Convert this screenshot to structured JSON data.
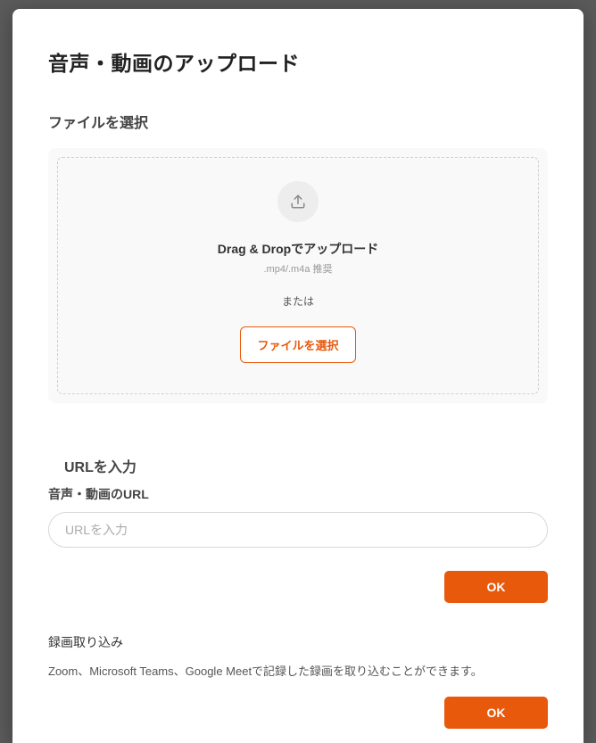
{
  "modal": {
    "title": "音声・動画のアップロード"
  },
  "fileSelect": {
    "sectionLabel": "ファイルを選択",
    "dropTitle": "Drag & Dropでアップロード",
    "dropSub": ".mp4/.m4a 推奨",
    "or": "または",
    "buttonLabel": "ファイルを選択"
  },
  "urlSection": {
    "title": "URLを入力",
    "subLabel": "音声・動画のURL",
    "placeholder": "URLを入力",
    "value": "",
    "okLabel": "OK"
  },
  "importSection": {
    "title": "録画取り込み",
    "description": "Zoom、Microsoft Teams、Google Meetで記録した録画を取り込むことができます。",
    "okLabel": "OK"
  },
  "colors": {
    "accent": "#e8590c"
  }
}
